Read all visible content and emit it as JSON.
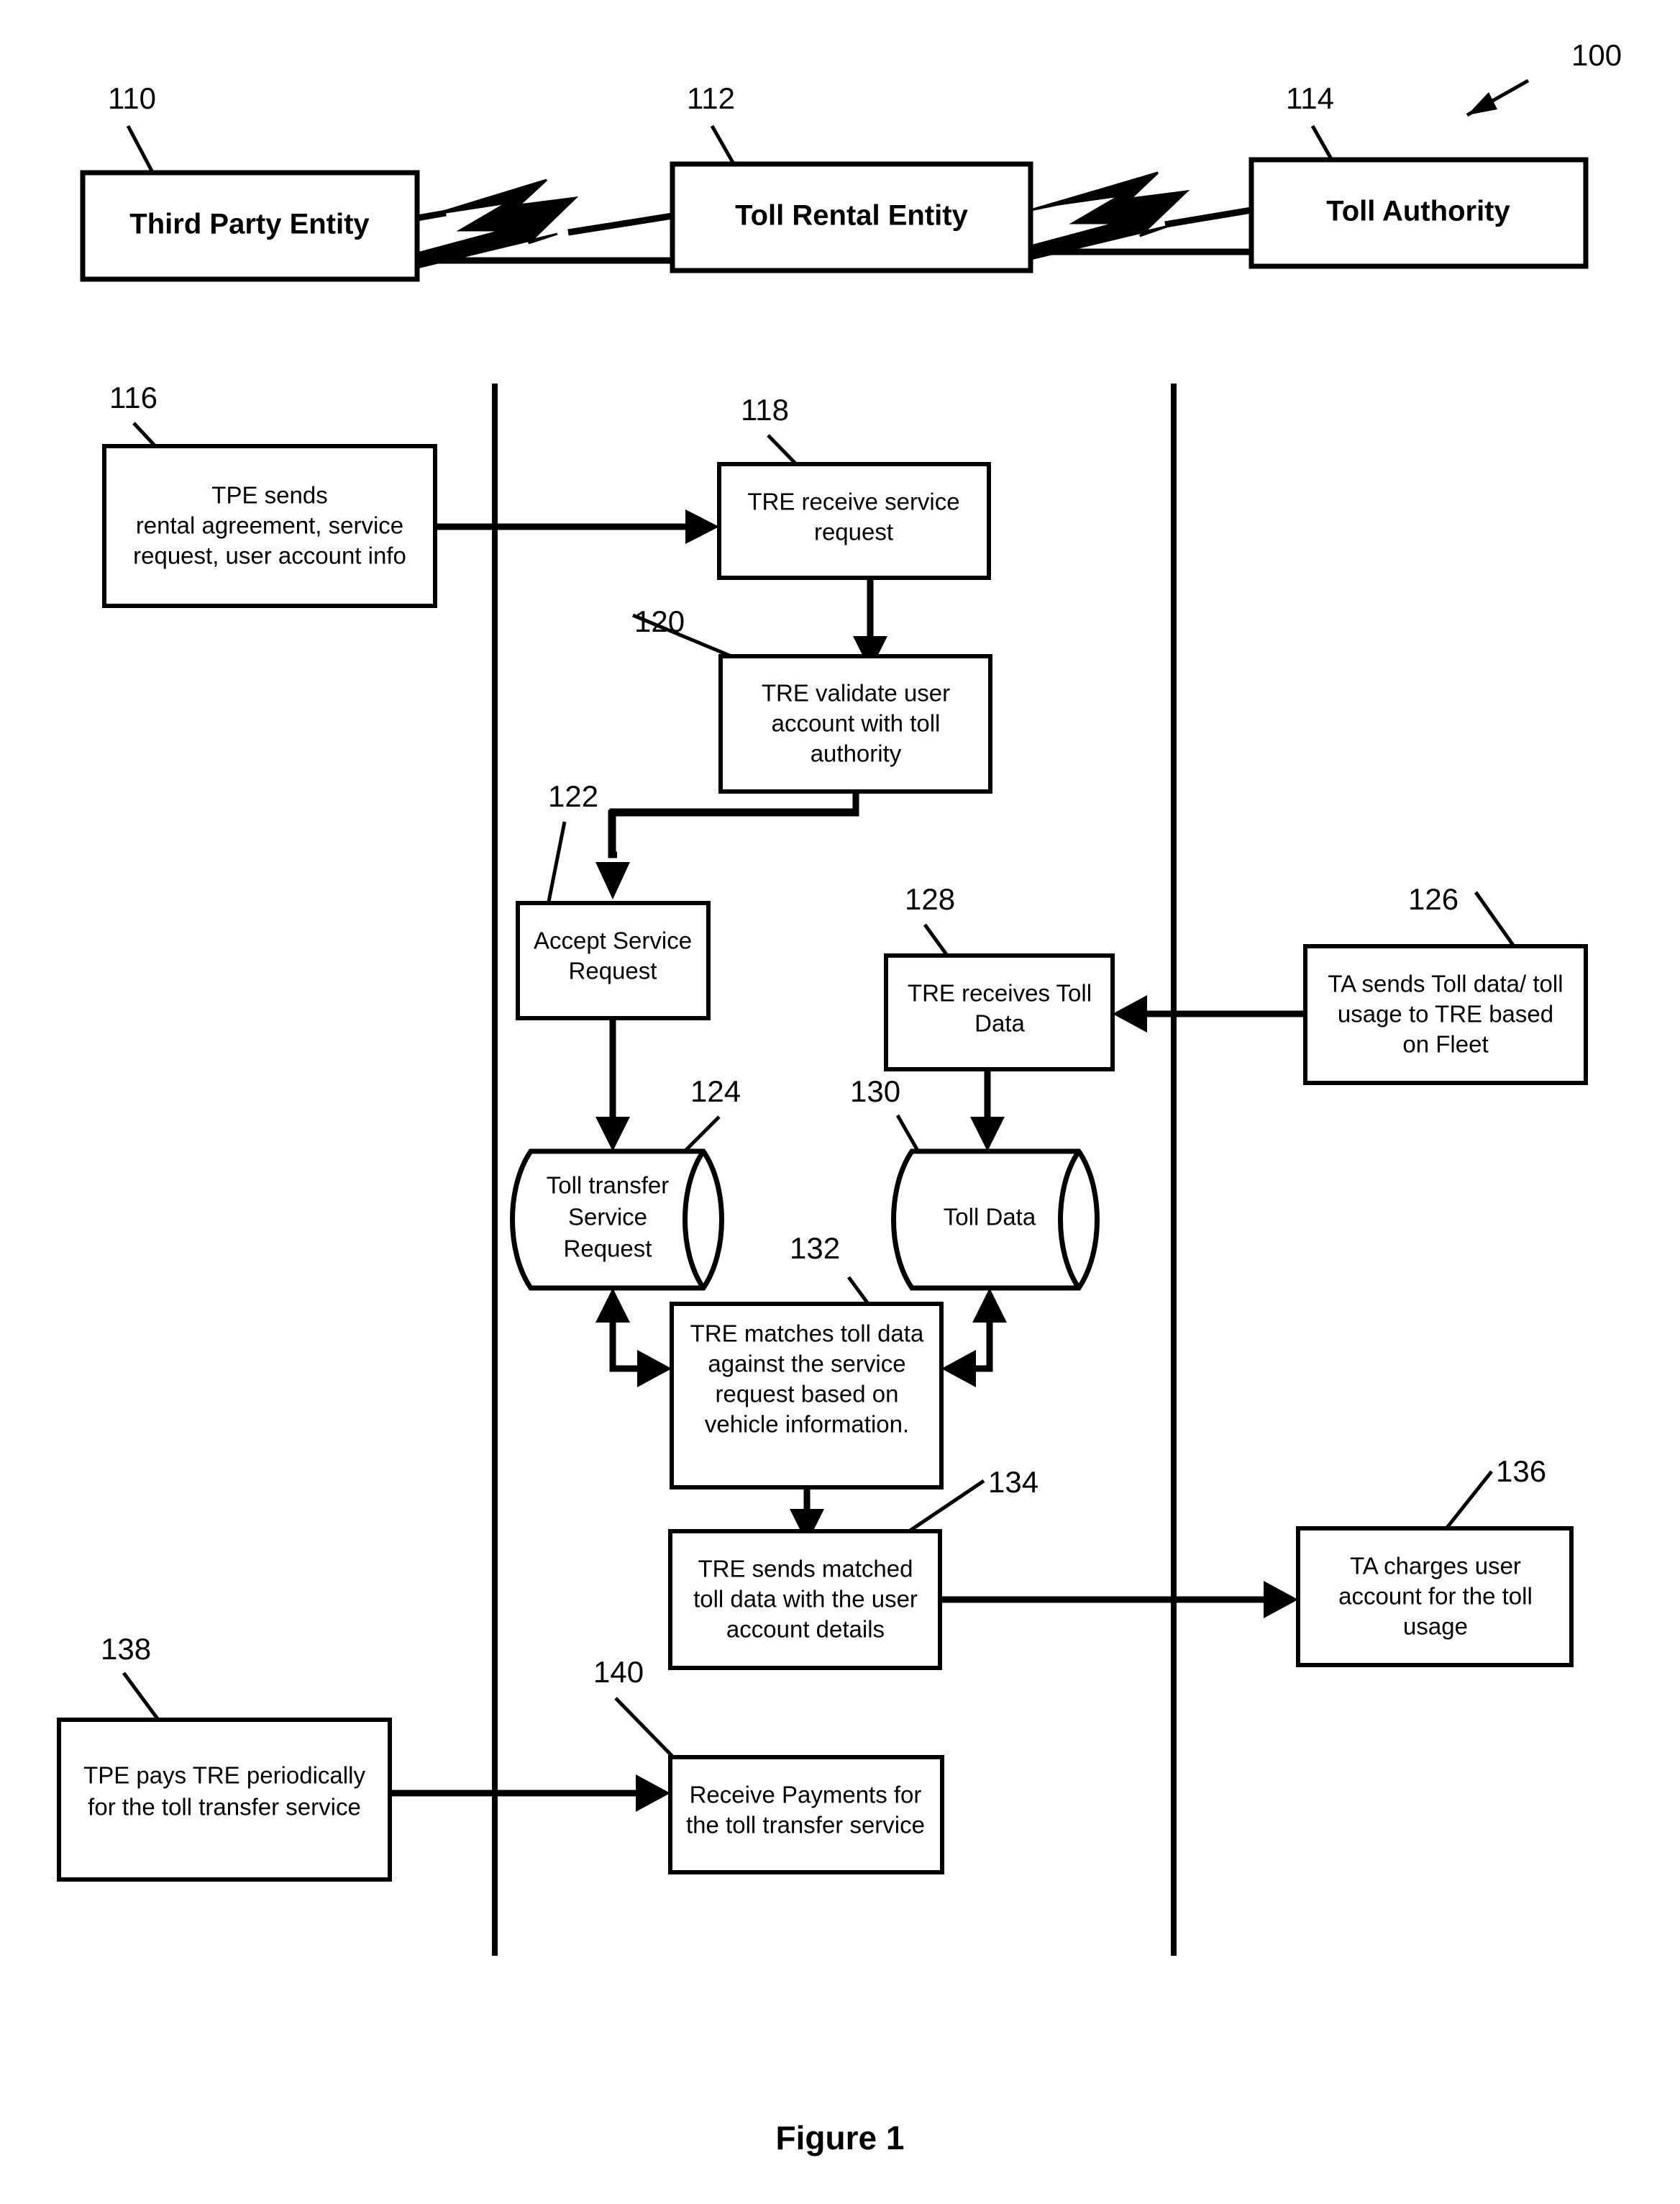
{
  "figure": {
    "caption": "Figure 1",
    "overall_ref": "100"
  },
  "entities": [
    {
      "ref": "110",
      "label": "Third Party Entity"
    },
    {
      "ref": "112",
      "label": "Toll Rental Entity"
    },
    {
      "ref": "114",
      "label": "Toll Authority"
    }
  ],
  "steps": [
    {
      "ref": "116",
      "shape": "rect",
      "lines": [
        "TPE sends",
        "rental agreement, service",
        "request, user account info"
      ]
    },
    {
      "ref": "118",
      "shape": "rect",
      "lines": [
        "TRE receive service",
        "request"
      ]
    },
    {
      "ref": "120",
      "shape": "rect",
      "lines": [
        "TRE validate user",
        "account with toll",
        "authority"
      ]
    },
    {
      "ref": "122",
      "shape": "rect",
      "lines": [
        "Accept Service",
        "Request"
      ]
    },
    {
      "ref": "124",
      "shape": "cylinder",
      "lines": [
        "Toll transfer",
        "Service",
        "Request"
      ]
    },
    {
      "ref": "126",
      "shape": "rect",
      "lines": [
        "TA sends Toll data/ toll",
        "usage to TRE based",
        "on Fleet"
      ]
    },
    {
      "ref": "128",
      "shape": "rect",
      "lines": [
        "TRE receives Toll",
        "Data"
      ]
    },
    {
      "ref": "130",
      "shape": "cylinder",
      "lines": [
        "Toll Data"
      ]
    },
    {
      "ref": "132",
      "shape": "rect",
      "lines": [
        "TRE matches toll data",
        "against the service",
        "request based on",
        "vehicle information."
      ]
    },
    {
      "ref": "134",
      "shape": "rect",
      "lines": [
        "TRE sends matched",
        "toll data with the user",
        "account details"
      ]
    },
    {
      "ref": "136",
      "shape": "rect",
      "lines": [
        "TA charges user",
        "account for the toll",
        "usage"
      ]
    },
    {
      "ref": "138",
      "shape": "rect",
      "lines": [
        "TPE pays TRE periodically",
        "for the toll transfer service"
      ]
    },
    {
      "ref": "140",
      "shape": "rect",
      "lines": [
        "Receive Payments for",
        "the toll transfer service"
      ]
    }
  ],
  "colors": {
    "stroke": "#000000",
    "fill": "#ffffff"
  }
}
